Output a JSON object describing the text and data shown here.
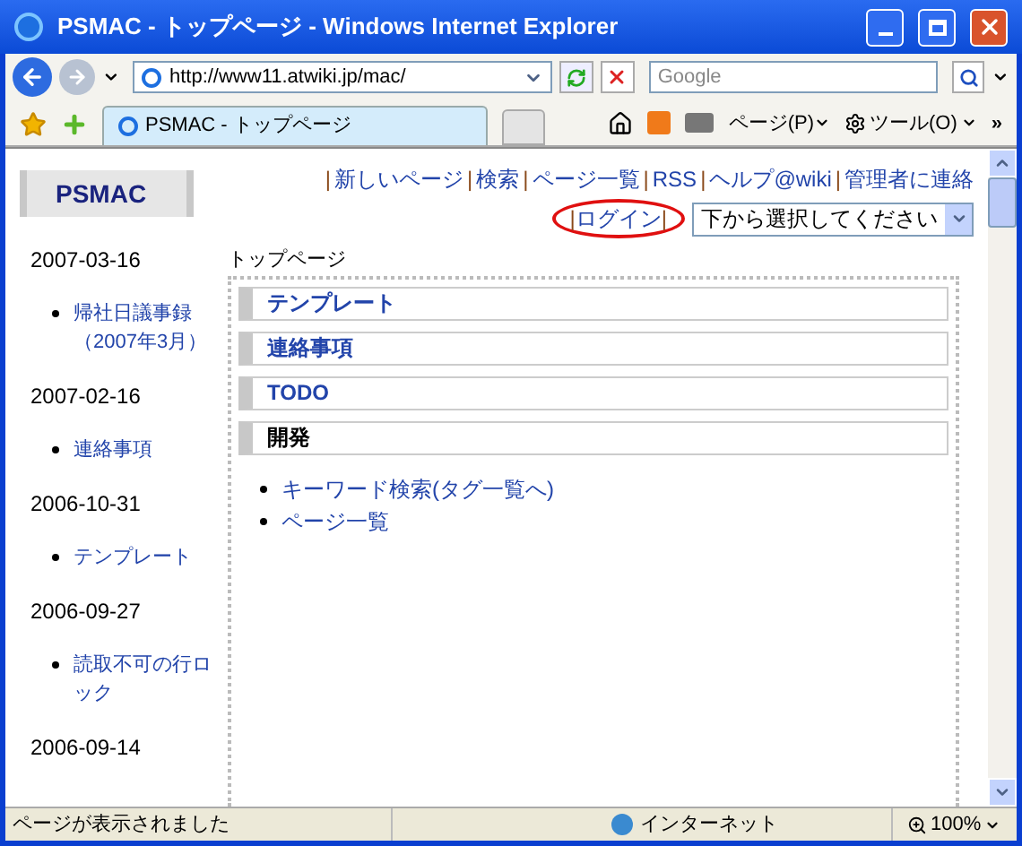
{
  "window": {
    "title": "PSMAC - トップページ - Windows Internet Explorer"
  },
  "address_bar": {
    "url": "http://www11.atwiki.jp/mac/"
  },
  "search": {
    "placeholder": "Google"
  },
  "tab": {
    "label": "PSMAC - トップページ",
    "selected": true
  },
  "toolbar": {
    "page_menu": "ページ(P)",
    "tools_menu": "ツール(O)",
    "overflow": "»"
  },
  "site": {
    "logo": "PSMAC",
    "nav": [
      {
        "kind": "sep",
        "label": "|"
      },
      {
        "kind": "link",
        "label": "新しいページ"
      },
      {
        "kind": "sep",
        "label": "|"
      },
      {
        "kind": "link",
        "label": "検索"
      },
      {
        "kind": "sep",
        "label": "|"
      },
      {
        "kind": "link",
        "label": "ページ一覧"
      },
      {
        "kind": "sep",
        "label": "|"
      },
      {
        "kind": "link",
        "label": "RSS"
      },
      {
        "kind": "sep",
        "label": "|"
      },
      {
        "kind": "link",
        "label": "ヘルプ@wiki"
      },
      {
        "kind": "sep",
        "label": "|"
      },
      {
        "kind": "link",
        "label": "管理者に連絡"
      }
    ],
    "login": {
      "left": "|",
      "label": "ログイン",
      "right": "|",
      "highlighted": true
    },
    "select": {
      "value": "下から選択してください"
    }
  },
  "sidebar": [
    {
      "date": "2007-03-16",
      "links": [
        "帰社日議事録（2007年3月）"
      ]
    },
    {
      "date": "2007-02-16",
      "links": [
        "連絡事項"
      ]
    },
    {
      "date": "2006-10-31",
      "links": [
        "テンプレート"
      ]
    },
    {
      "date": "2006-09-27",
      "links": [
        "読取不可の行ロック"
      ]
    },
    {
      "date": "2006-09-14"
    }
  ],
  "main": {
    "breadcrumb": "トップページ",
    "sections": [
      {
        "title": "テンプレート",
        "kind": "link"
      },
      {
        "title": "連絡事項",
        "kind": "link"
      },
      {
        "title": "TODO",
        "kind": "link"
      },
      {
        "title": "開発",
        "kind": "plain"
      }
    ],
    "links": [
      "キーワード検索(タグ一覧へ)",
      "ページ一覧"
    ]
  },
  "status_bar": {
    "message": "ページが表示されました",
    "zone": "インターネット",
    "zoom": "100%"
  }
}
